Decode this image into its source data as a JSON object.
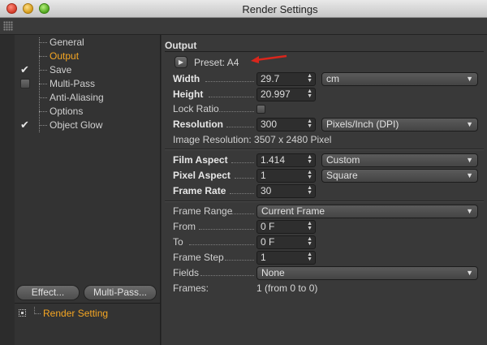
{
  "window": {
    "title": "Render Settings"
  },
  "sidebar": {
    "items": [
      {
        "label": "General",
        "checked": null,
        "active": false
      },
      {
        "label": "Output",
        "checked": null,
        "active": true
      },
      {
        "label": "Save",
        "checked": true,
        "active": false
      },
      {
        "label": "Multi-Pass",
        "checked": false,
        "active": false
      },
      {
        "label": "Anti-Aliasing",
        "checked": null,
        "active": false
      },
      {
        "label": "Options",
        "checked": null,
        "active": false
      },
      {
        "label": "Object Glow",
        "checked": true,
        "active": false
      }
    ],
    "effect_button": "Effect...",
    "multipass_button": "Multi-Pass...",
    "render_setting": "Render Setting"
  },
  "output": {
    "section_title": "Output",
    "preset_label": "Preset: A4",
    "width": {
      "label": "Width",
      "value": "29.7",
      "unit": "cm"
    },
    "height": {
      "label": "Height",
      "value": "20.997"
    },
    "lock_ratio": {
      "label": "Lock Ratio",
      "checked": false
    },
    "resolution": {
      "label": "Resolution",
      "value": "300",
      "unit": "Pixels/Inch (DPI)"
    },
    "image_resolution": "Image Resolution: 3507 x 2480 Pixel",
    "film_aspect": {
      "label": "Film Aspect",
      "value": "1.414",
      "mode": "Custom"
    },
    "pixel_aspect": {
      "label": "Pixel Aspect",
      "value": "1",
      "mode": "Square"
    },
    "frame_rate": {
      "label": "Frame Rate",
      "value": "30"
    },
    "frame_range": {
      "label": "Frame Range",
      "value": "Current Frame"
    },
    "from": {
      "label": "From",
      "value": "0 F"
    },
    "to": {
      "label": "To",
      "value": "0 F"
    },
    "frame_step": {
      "label": "Frame Step",
      "value": "1"
    },
    "fields": {
      "label": "Fields",
      "value": "None"
    },
    "frames": {
      "label": "Frames:",
      "value": "1 (from 0 to 0)"
    }
  },
  "colors": {
    "accent": "#f5a623",
    "annotation_arrow": "#d9261c"
  }
}
